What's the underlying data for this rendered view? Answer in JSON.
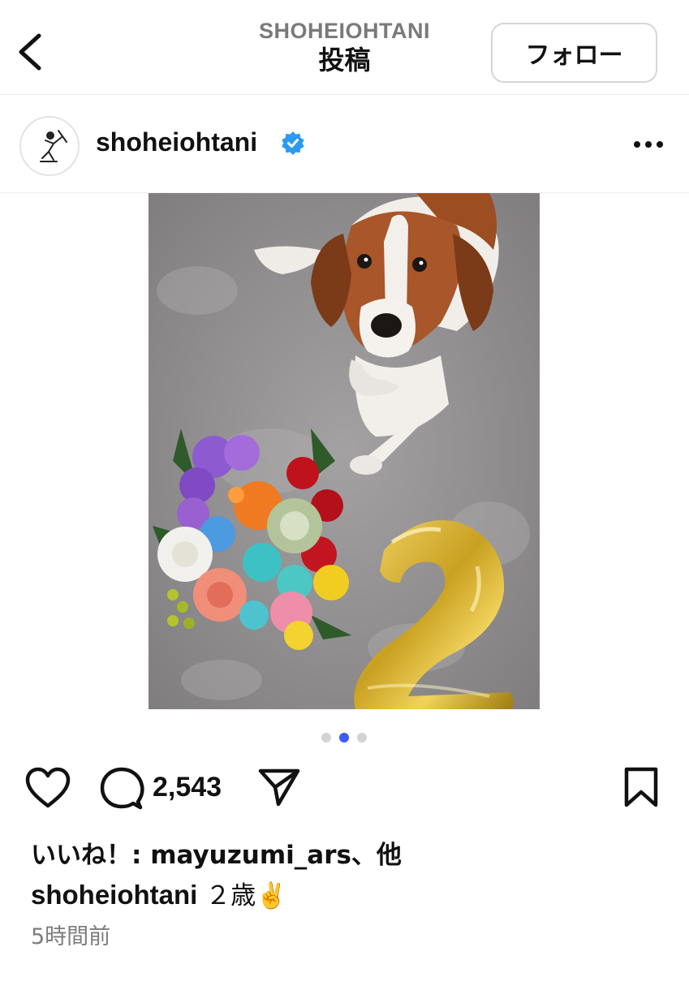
{
  "header": {
    "account": "SHOHEIOHTANI",
    "title": "投稿",
    "follow_label": "フォロー"
  },
  "post": {
    "username": "shoheiohtani",
    "verified": true,
    "comment_count": "2,543",
    "likes_text": "いいね！: mayuzumi_ars、他",
    "caption_user": "shoheiohtani",
    "caption_text": "２歳",
    "caption_emoji": "✌️",
    "time": "5時間前",
    "carousel": {
      "total": 3,
      "active": 2
    },
    "balloon_number": "2"
  },
  "icons": {
    "back": "chevron-left-icon",
    "verified": "verified-badge-icon",
    "more": "more-horizontal-icon",
    "like": "heart-icon",
    "comment": "comment-bubble-icon",
    "share": "paper-plane-icon",
    "save": "bookmark-icon"
  },
  "colors": {
    "verified_blue": "#2b9af3",
    "carousel_active": "#3d5bf5"
  }
}
